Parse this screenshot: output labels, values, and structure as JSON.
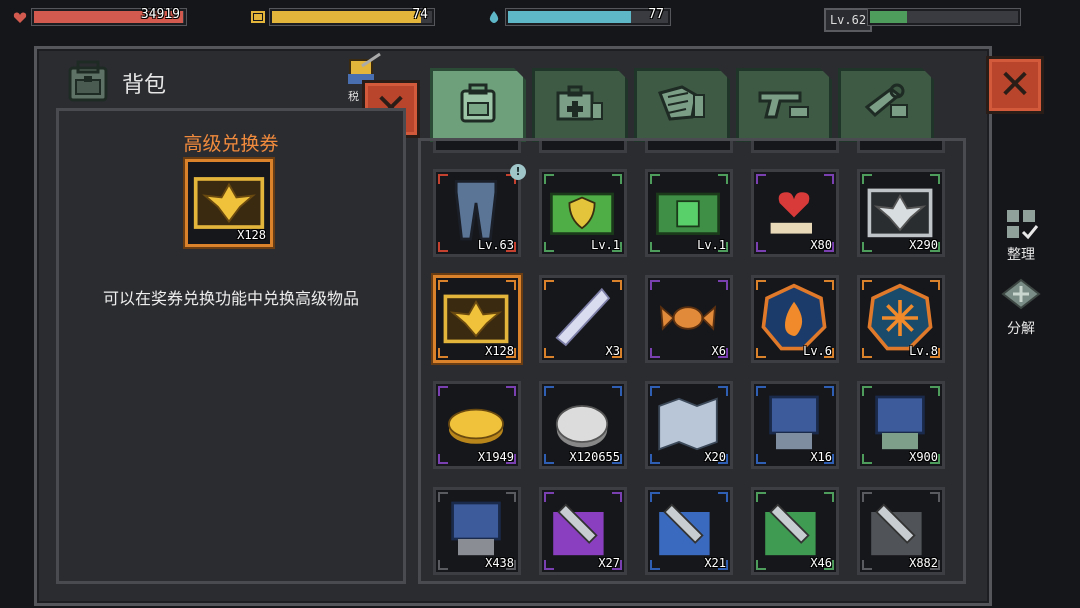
{
  "hud": {
    "hp": {
      "value": "34919",
      "fill": 0.99,
      "color": "#d25a4f",
      "icon": "heart-icon"
    },
    "energy": {
      "value": "74",
      "fill": 0.93,
      "color": "#e3b53b",
      "icon": "battery-icon"
    },
    "water": {
      "value": "77",
      "fill": 0.77,
      "color": "#5eb7c7",
      "icon": "water-drop-icon"
    },
    "level": {
      "label": "Lv.62",
      "fill": 0.25,
      "color": "#4f9d5c"
    }
  },
  "bag": {
    "title": "背包",
    "icon": "backpack-icon",
    "decor_label": "税"
  },
  "detail": {
    "name": "高级兑换券",
    "count": "X128",
    "description": "可以在奖券兑换功能中兑换高级物品"
  },
  "tabs": [
    {
      "icon": "backpack-icon",
      "active": true
    },
    {
      "icon": "medkit-icon",
      "active": false
    },
    {
      "icon": "armor-icon",
      "active": false
    },
    {
      "icon": "pistol-icon",
      "active": false
    },
    {
      "icon": "wrench-icon",
      "active": false
    }
  ],
  "items": [
    {
      "icon": "pants-icon",
      "label": "Lv.63",
      "rarity": "#c4402f",
      "new": "!"
    },
    {
      "icon": "shield-case-icon",
      "label": "Lv.1",
      "rarity": "#4f9d5c"
    },
    {
      "icon": "fist-case-icon",
      "label": "Lv.1",
      "rarity": "#4f9d5c"
    },
    {
      "icon": "heart-hand-icon",
      "label": "X80",
      "rarity": "#7a3fb0"
    },
    {
      "icon": "silver-ticket-icon",
      "label": "X290",
      "rarity": "#4f9d5c"
    },
    {
      "icon": "gold-ticket-icon",
      "label": "X128",
      "rarity": "#d9822b",
      "selected": true
    },
    {
      "icon": "crystal-shard-icon",
      "label": "X3",
      "rarity": "#d9822b"
    },
    {
      "icon": "candy-icon",
      "label": "X6",
      "rarity": "#7a3fb0"
    },
    {
      "icon": "fire-chip-icon",
      "label": "Lv.6",
      "rarity": "#d9822b"
    },
    {
      "icon": "burst-chip-icon",
      "label": "Lv.8",
      "rarity": "#d9822b"
    },
    {
      "icon": "gold-coin-icon",
      "label": "X1949",
      "rarity": "#7a3fb0"
    },
    {
      "icon": "silver-coin-icon",
      "label": "X120655",
      "rarity": "#2e5fb5"
    },
    {
      "icon": "map-icon",
      "label": "X20",
      "rarity": "#2e5fb5"
    },
    {
      "icon": "chip-blue-icon",
      "label": "X16",
      "rarity": "#2e5fb5"
    },
    {
      "icon": "chip-green-icon",
      "label": "X900",
      "rarity": "#4f9d5c"
    },
    {
      "icon": "chip-gray-icon",
      "label": "X438",
      "rarity": "#5a5b61"
    },
    {
      "icon": "wrench-purple-icon",
      "label": "X27",
      "rarity": "#7a3fb0"
    },
    {
      "icon": "wrench-blue-icon",
      "label": "X21",
      "rarity": "#2e5fb5"
    },
    {
      "icon": "wrench-green-icon",
      "label": "X46",
      "rarity": "#4f9d5c"
    },
    {
      "icon": "wrench-gray-icon",
      "label": "X882",
      "rarity": "#5a5b61"
    }
  ],
  "side": {
    "sort": "整理",
    "decompose": "分解"
  }
}
